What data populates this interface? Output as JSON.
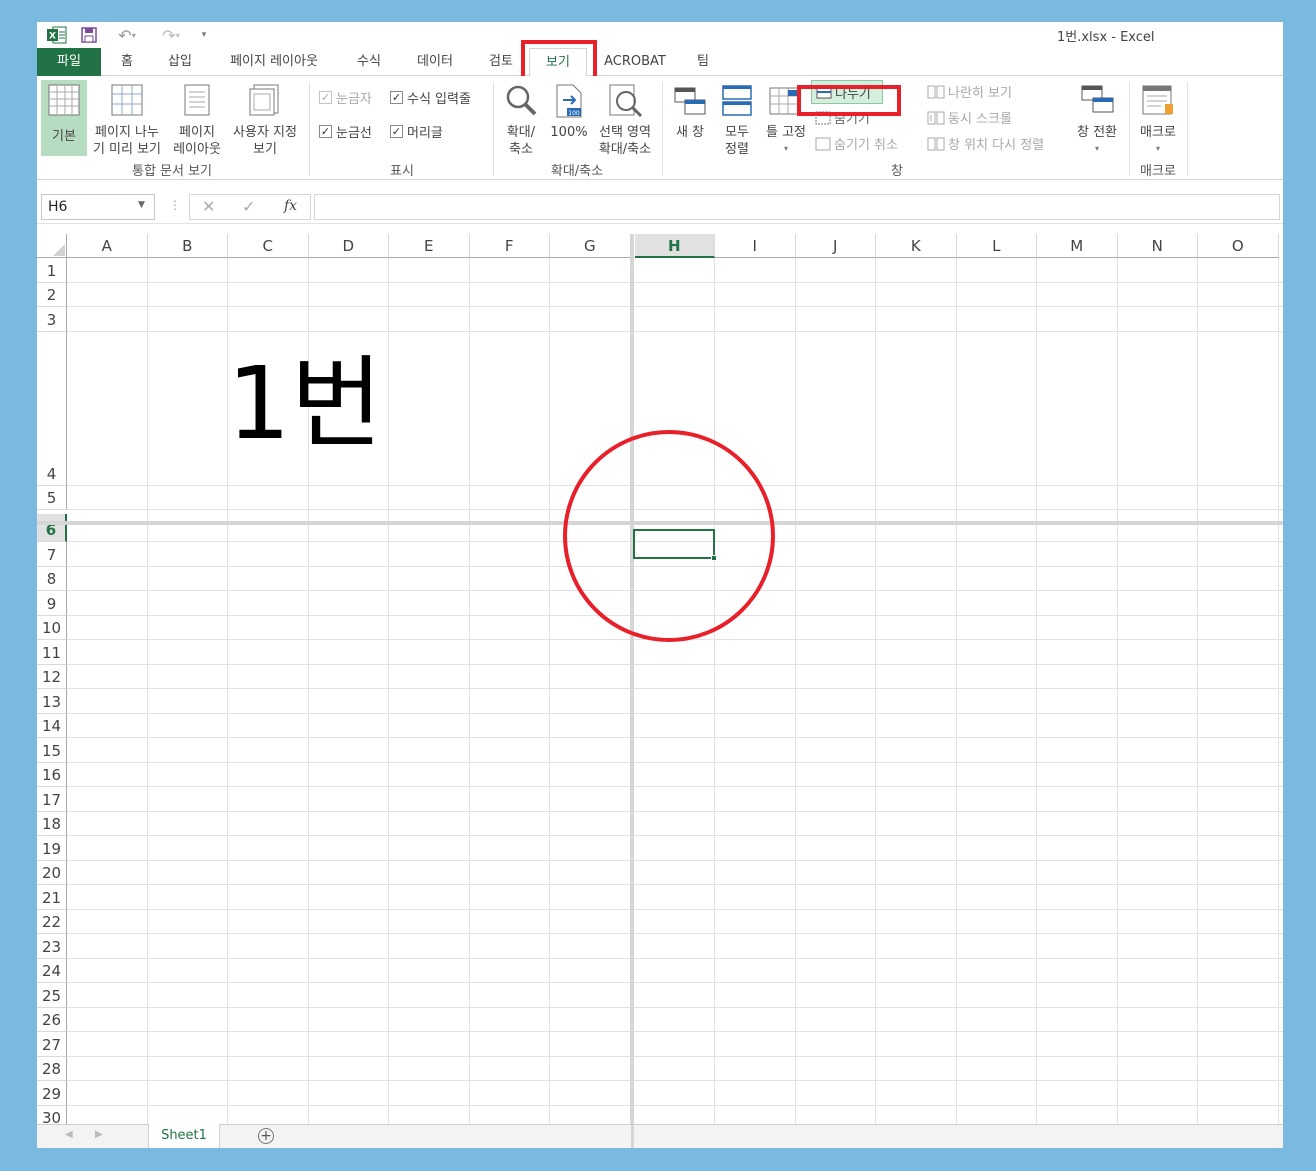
{
  "title": {
    "text": "1번.xlsx - Excel"
  },
  "tabs": [
    "파일",
    "홈",
    "삽입",
    "페이지 레이아웃",
    "수식",
    "데이터",
    "검토",
    "보기",
    "ACROBAT",
    "팀"
  ],
  "active_tab": "보기",
  "ribbon": {
    "views": {
      "normal": "기본",
      "page_break_1": "페이지 나누",
      "page_break_2": "기 미리 보기",
      "page_layout_1": "페이지",
      "page_layout_2": "레이아웃",
      "custom_1": "사용자 지정",
      "custom_2": "보기",
      "group_label": "통합 문서 보기"
    },
    "show": {
      "ruler": "눈금자",
      "formula_bar": "수식 입력줄",
      "gridlines": "눈금선",
      "headings": "머리글",
      "group_label": "표시"
    },
    "zoom": {
      "zoom_1": "확대/",
      "zoom_2": "축소",
      "hundred": "100%",
      "selection_1": "선택 영역",
      "selection_2": "확대/축소",
      "group_label": "확대/축소"
    },
    "window": {
      "new_window": "새 창",
      "arrange_1": "모두",
      "arrange_2": "정렬",
      "freeze": "틀 고정",
      "split": "나누기",
      "hide": "숨기기",
      "unhide": "숨기기 취소",
      "side_by_side": "나란히 보기",
      "sync_scroll": "동시 스크롤",
      "reset_position": "창 위치 다시 정렬",
      "switch": "창 전환",
      "group_label": "창"
    },
    "macros": {
      "label": "매크로",
      "group_label": "매크로"
    }
  },
  "formula_bar": {
    "name_box": "H6",
    "fx": "fx",
    "value": ""
  },
  "columns": [
    "A",
    "B",
    "C",
    "D",
    "E",
    "F",
    "G",
    "H",
    "I",
    "J",
    "K",
    "L",
    "M",
    "N",
    "O"
  ],
  "rows": [
    "1",
    "2",
    "3",
    "4",
    "5",
    "6",
    "7",
    "8",
    "9",
    "10",
    "11",
    "12",
    "13",
    "14",
    "15",
    "16",
    "17",
    "18",
    "19",
    "20",
    "21",
    "22",
    "23",
    "24",
    "25",
    "26",
    "27",
    "28",
    "29",
    "30"
  ],
  "selected_cell": "H6",
  "cell_C4": "1번",
  "sheets": [
    "Sheet1"
  ],
  "colors": {
    "accent": "#217346",
    "highlight": "#e8202a",
    "page_bg": "#7ab9e0"
  }
}
